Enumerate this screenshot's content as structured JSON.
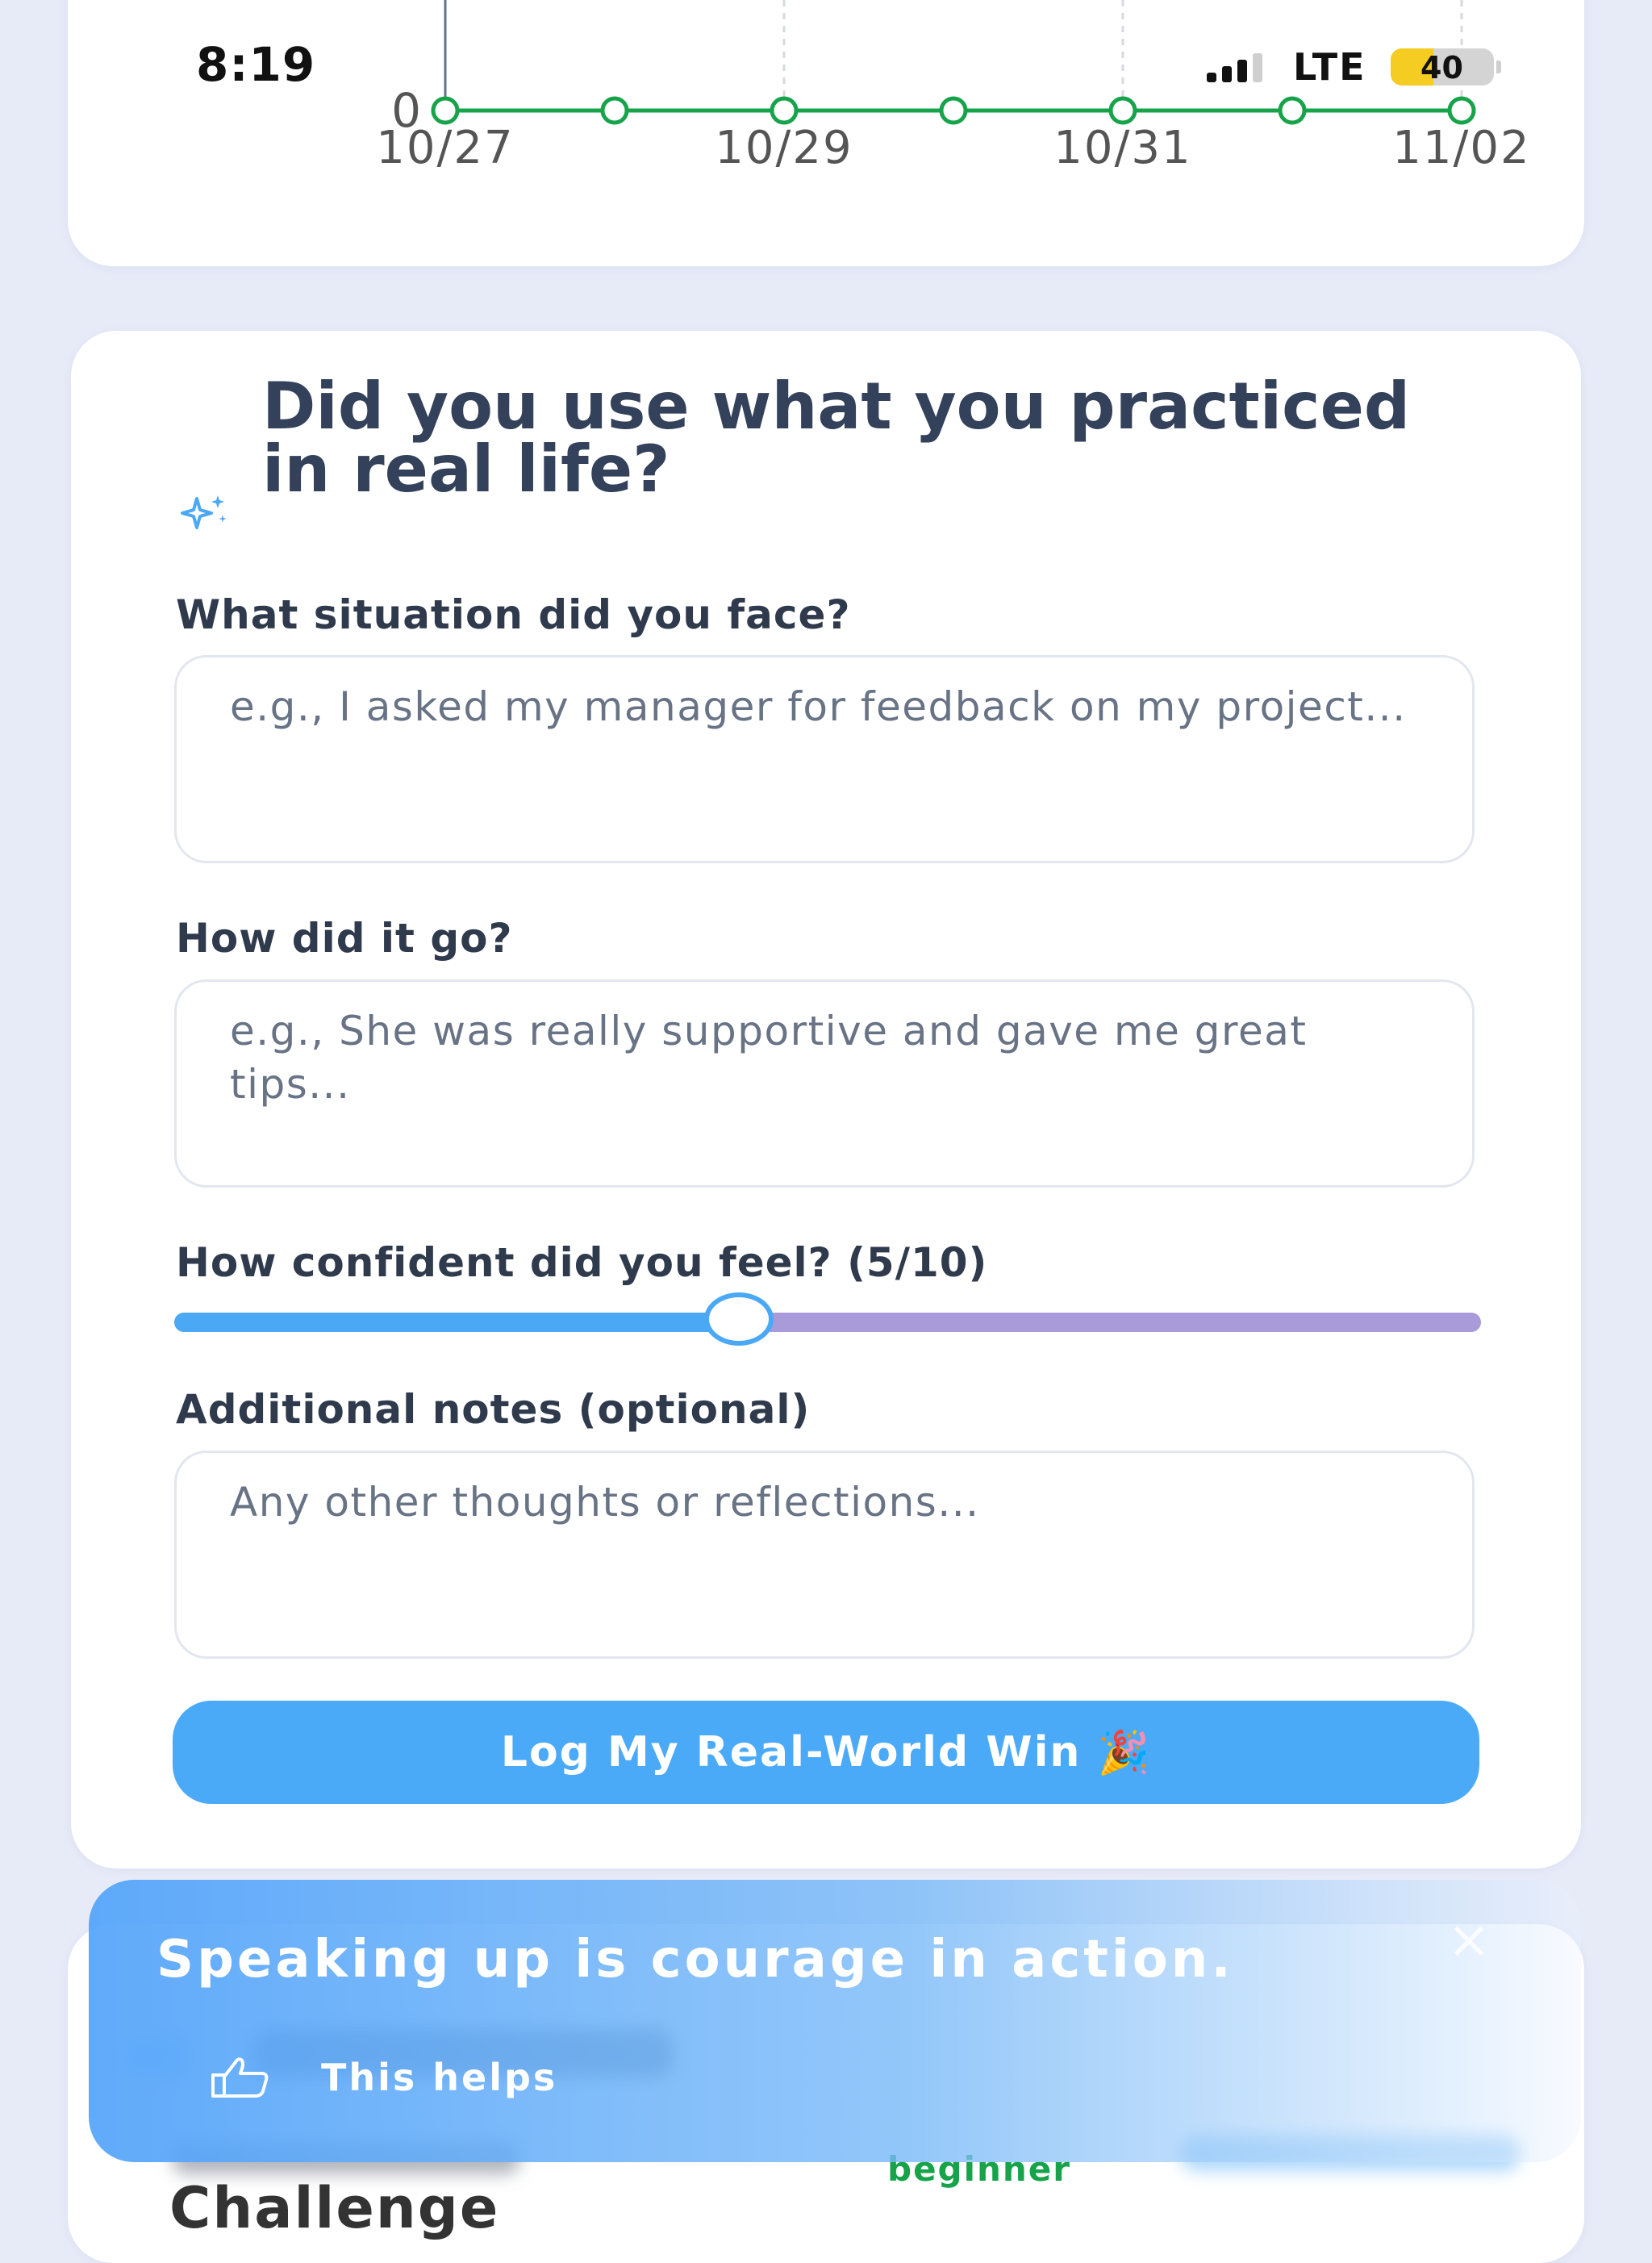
{
  "status_bar": {
    "time": "8:19",
    "network": "LTE",
    "battery": "40"
  },
  "chart_data": {
    "type": "line",
    "x": [
      "10/27",
      "10/28",
      "10/29",
      "10/30",
      "10/31",
      "11/01",
      "11/02"
    ],
    "tick_labels": [
      "10/27",
      "10/29",
      "10/31",
      "11/02"
    ],
    "series": [
      {
        "values": [
          0,
          0,
          0,
          0,
          0,
          0,
          0
        ]
      }
    ],
    "y_tick_labels": [
      "0"
    ],
    "grid": "dashed vertical",
    "line_color": "#16a34a"
  },
  "form": {
    "title": "Did you use what you practiced in real life?",
    "situation_label": "What situation did you face?",
    "situation_placeholder": "e.g., I asked my manager for feedback on my project...",
    "outcome_label": "How did it go?",
    "outcome_placeholder": "e.g., She was really supportive and gave me great tips...",
    "confidence_label": "How confident did you feel? (5/10)",
    "confidence_value": 5,
    "confidence_max": 10,
    "notes_label": "Additional notes (optional)",
    "notes_placeholder": "Any other thoughts or reflections...",
    "submit_label": "Log My Real-World Win",
    "submit_emoji": "🎉"
  },
  "bottom": {
    "level": "beginner",
    "section_title": "Challenge"
  },
  "toast": {
    "message": "Speaking up is courage in action.",
    "helps_label": "This helps"
  },
  "colors": {
    "background": "#e7ebf8",
    "accent": "#4aaaf8",
    "slider_rest": "#a99ada",
    "chart_line": "#16a34a"
  }
}
